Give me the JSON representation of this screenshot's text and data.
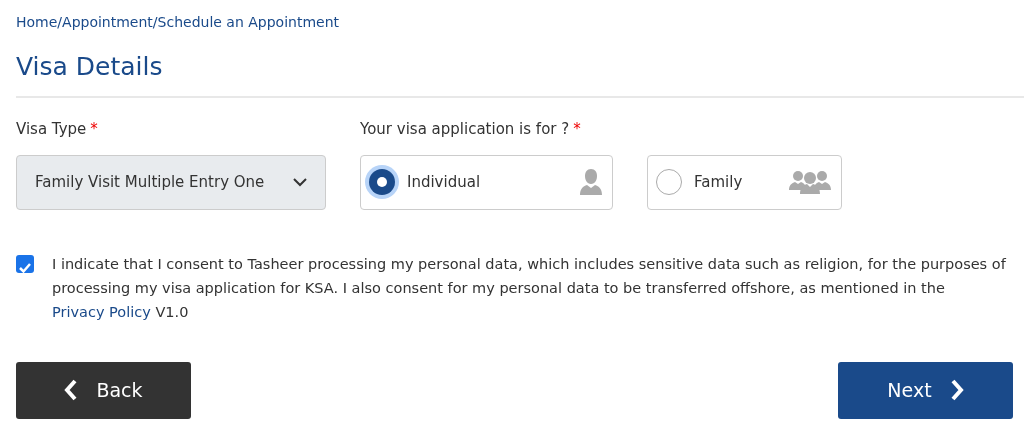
{
  "breadcrumb": "Home/Appointment/Schedule an Appointment",
  "title": "Visa Details",
  "visa_type": {
    "label": "Visa Type",
    "required_mark": "*",
    "value": "Family Visit Multiple Entry One"
  },
  "application_for": {
    "label": "Your visa application is for ?",
    "required_mark": "*",
    "options": [
      {
        "label": "Individual",
        "kind": "person",
        "selected": true
      },
      {
        "label": "Family",
        "kind": "group",
        "selected": false
      }
    ]
  },
  "consent": {
    "checked": true,
    "text": "I indicate that I consent to Tasheer processing my personal data, which includes sensitive data such as religion, for the purposes of processing my visa application for KSA. I also consent for my personal data to be transferred offshore, as mentioned in the",
    "link": "Privacy Policy",
    "text_after": "V1.0"
  },
  "buttons": [
    {
      "label": "Back",
      "kind": "back"
    },
    {
      "label": "Next",
      "kind": "next"
    }
  ]
}
